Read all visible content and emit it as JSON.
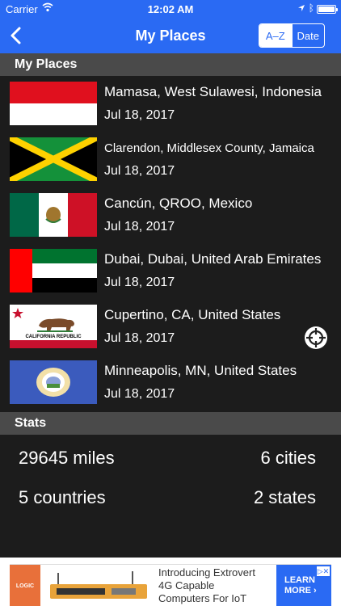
{
  "status_bar": {
    "carrier": "Carrier",
    "time": "12:02 AM"
  },
  "nav": {
    "title": "My Places",
    "sort_az": "A–Z",
    "sort_date": "Date"
  },
  "places_section": {
    "header": "My Places"
  },
  "places": [
    {
      "name": "Mamasa, West Sulawesi, Indonesia",
      "date": "Jul 18, 2017",
      "flag": "indonesia-flag"
    },
    {
      "name": "Clarendon, Middlesex County, Jamaica",
      "date": "Jul 18, 2017",
      "flag": "jamaica-flag"
    },
    {
      "name": "Cancún, QROO, Mexico",
      "date": "Jul 18, 2017",
      "flag": "mexico-flag"
    },
    {
      "name": "Dubai, Dubai, United Arab Emirates",
      "date": "Jul 18, 2017",
      "flag": "uae-flag"
    },
    {
      "name": "Cupertino, CA, United States",
      "date": "Jul 18, 2017",
      "flag": "california-flag"
    },
    {
      "name": "Minneapolis, MN, United States",
      "date": "Jul 18, 2017",
      "flag": "minnesota-flag"
    }
  ],
  "california_flag_text": "CALIFORNIA  REPUBLIC",
  "stats_section": {
    "header": "Stats"
  },
  "stats": {
    "miles": "29645 miles",
    "cities": "6 cities",
    "countries": "5 countries",
    "states": "2 states"
  },
  "ad": {
    "brand": "LOGIC",
    "line1": "Introducing Extrovert",
    "line2": "4G Capable",
    "line3": "Computers For IoT",
    "cta_line1": "LEARN",
    "cta_line2": "MORE ›"
  },
  "colors": {
    "accent": "#2a6af3",
    "background": "#1c1c1c",
    "section_header": "#4a4a4a"
  }
}
